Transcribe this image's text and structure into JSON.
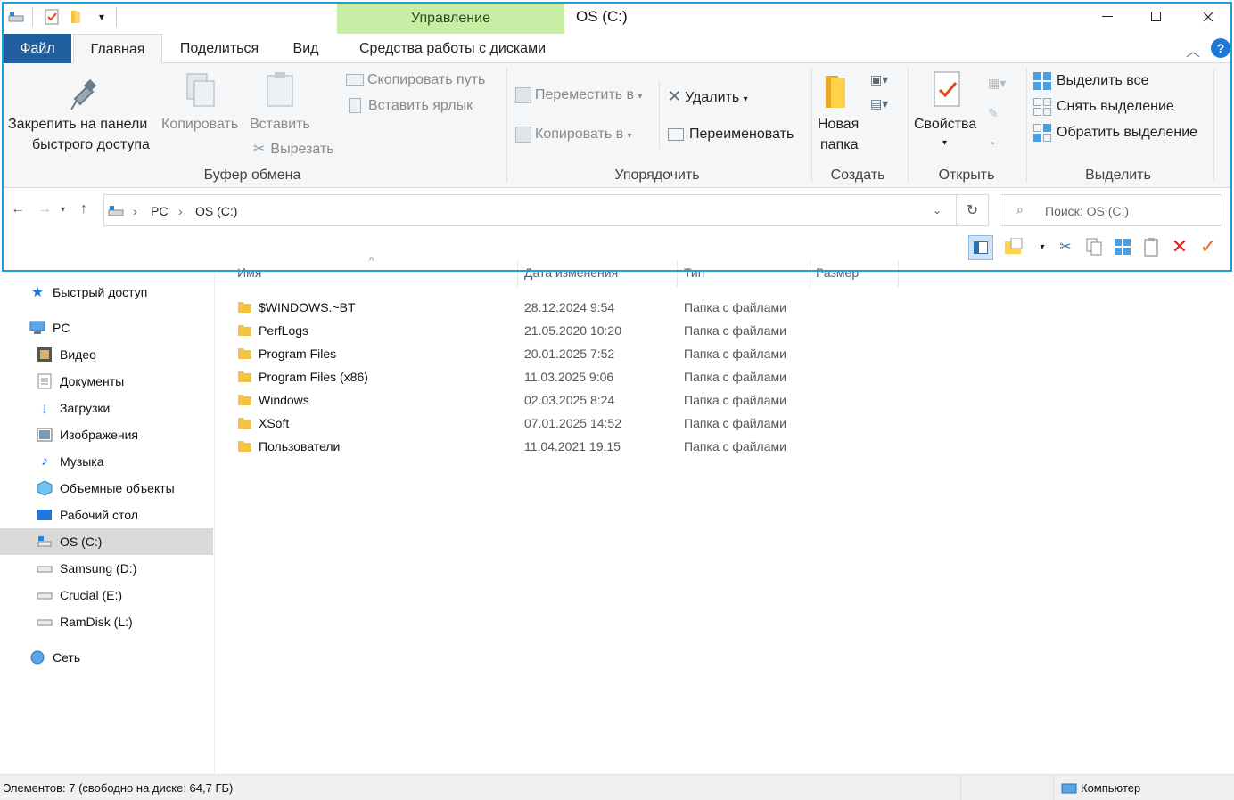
{
  "window": {
    "title": "OS (C:)",
    "context_tab": "Управление",
    "minimize": "—",
    "maximize": "☐",
    "close": "✕"
  },
  "tabs": [
    {
      "label": "Файл"
    },
    {
      "label": "Главная"
    },
    {
      "label": "Поделиться"
    },
    {
      "label": "Вид"
    },
    {
      "label": "Средства работы с дисками"
    }
  ],
  "ribbon": {
    "clipboard": {
      "pin_line1": "Закрепить на панели",
      "pin_line2": "быстрого доступа",
      "copy": "Копировать",
      "paste": "Вставить",
      "copy_path": "Скопировать путь",
      "paste_shortcut": "Вставить ярлык",
      "cut": "Вырезать",
      "group": "Буфер обмена"
    },
    "organize": {
      "move_to": "Переместить в",
      "copy_to": "Копировать в",
      "delete": "Удалить",
      "rename": "Переименовать",
      "group": "Упорядочить"
    },
    "new": {
      "new_folder_line1": "Новая",
      "new_folder_line2": "папка",
      "group": "Создать"
    },
    "open": {
      "properties": "Свойства",
      "group": "Открыть"
    },
    "select": {
      "select_all": "Выделить все",
      "select_none": "Снять выделение",
      "invert": "Обратить выделение",
      "group": "Выделить"
    }
  },
  "address": {
    "crumbs": [
      "PC",
      "OS (C:)"
    ],
    "search_placeholder": "Поиск: OS (C:)"
  },
  "columns": [
    "Имя",
    "Дата изменения",
    "Тип",
    "Размер"
  ],
  "nav": [
    {
      "label": "Быстрый доступ",
      "icon": "star-icon"
    },
    {
      "label": "PC",
      "icon": "computer-icon"
    },
    {
      "label": "Видео",
      "icon": "video-icon"
    },
    {
      "label": "Документы",
      "icon": "documents-icon"
    },
    {
      "label": "Загрузки",
      "icon": "download-icon"
    },
    {
      "label": "Изображения",
      "icon": "pictures-icon"
    },
    {
      "label": "Музыка",
      "icon": "music-icon"
    },
    {
      "label": "Объемные объекты",
      "icon": "3d-objects-icon"
    },
    {
      "label": "Рабочий стол",
      "icon": "desktop-icon"
    },
    {
      "label": "OS (C:)",
      "icon": "os-drive-icon"
    },
    {
      "label": "Samsung (D:)",
      "icon": "drive-icon"
    },
    {
      "label": "Crucial (E:)",
      "icon": "drive-icon"
    },
    {
      "label": "RamDisk (L:)",
      "icon": "drive-icon"
    },
    {
      "label": "Сеть",
      "icon": "network-icon"
    }
  ],
  "files": [
    {
      "name": "$WINDOWS.~BT",
      "date": "28.12.2024 9:54",
      "type": "Папка с файлами"
    },
    {
      "name": "PerfLogs",
      "date": "21.05.2020 10:20",
      "type": "Папка с файлами"
    },
    {
      "name": "Program Files",
      "date": "20.01.2025 7:52",
      "type": "Папка с файлами"
    },
    {
      "name": "Program Files (x86)",
      "date": "11.03.2025 9:06",
      "type": "Папка с файлами"
    },
    {
      "name": "Windows",
      "date": "02.03.2025 8:24",
      "type": "Папка с файлами"
    },
    {
      "name": "XSoft",
      "date": "07.01.2025 14:52",
      "type": "Папка с файлами"
    },
    {
      "name": "Пользователи",
      "date": "11.04.2021 19:15",
      "type": "Папка с файлами"
    }
  ],
  "status": {
    "items": "Элементов: 7 (свободно на диске: 64,7 ГБ)",
    "computer": "Компьютер"
  },
  "colors": {
    "accent": "#1ba1e2",
    "file_tab": "#1f5fa0",
    "context_tab": "#c6efa5",
    "folder": "#f5c342"
  }
}
